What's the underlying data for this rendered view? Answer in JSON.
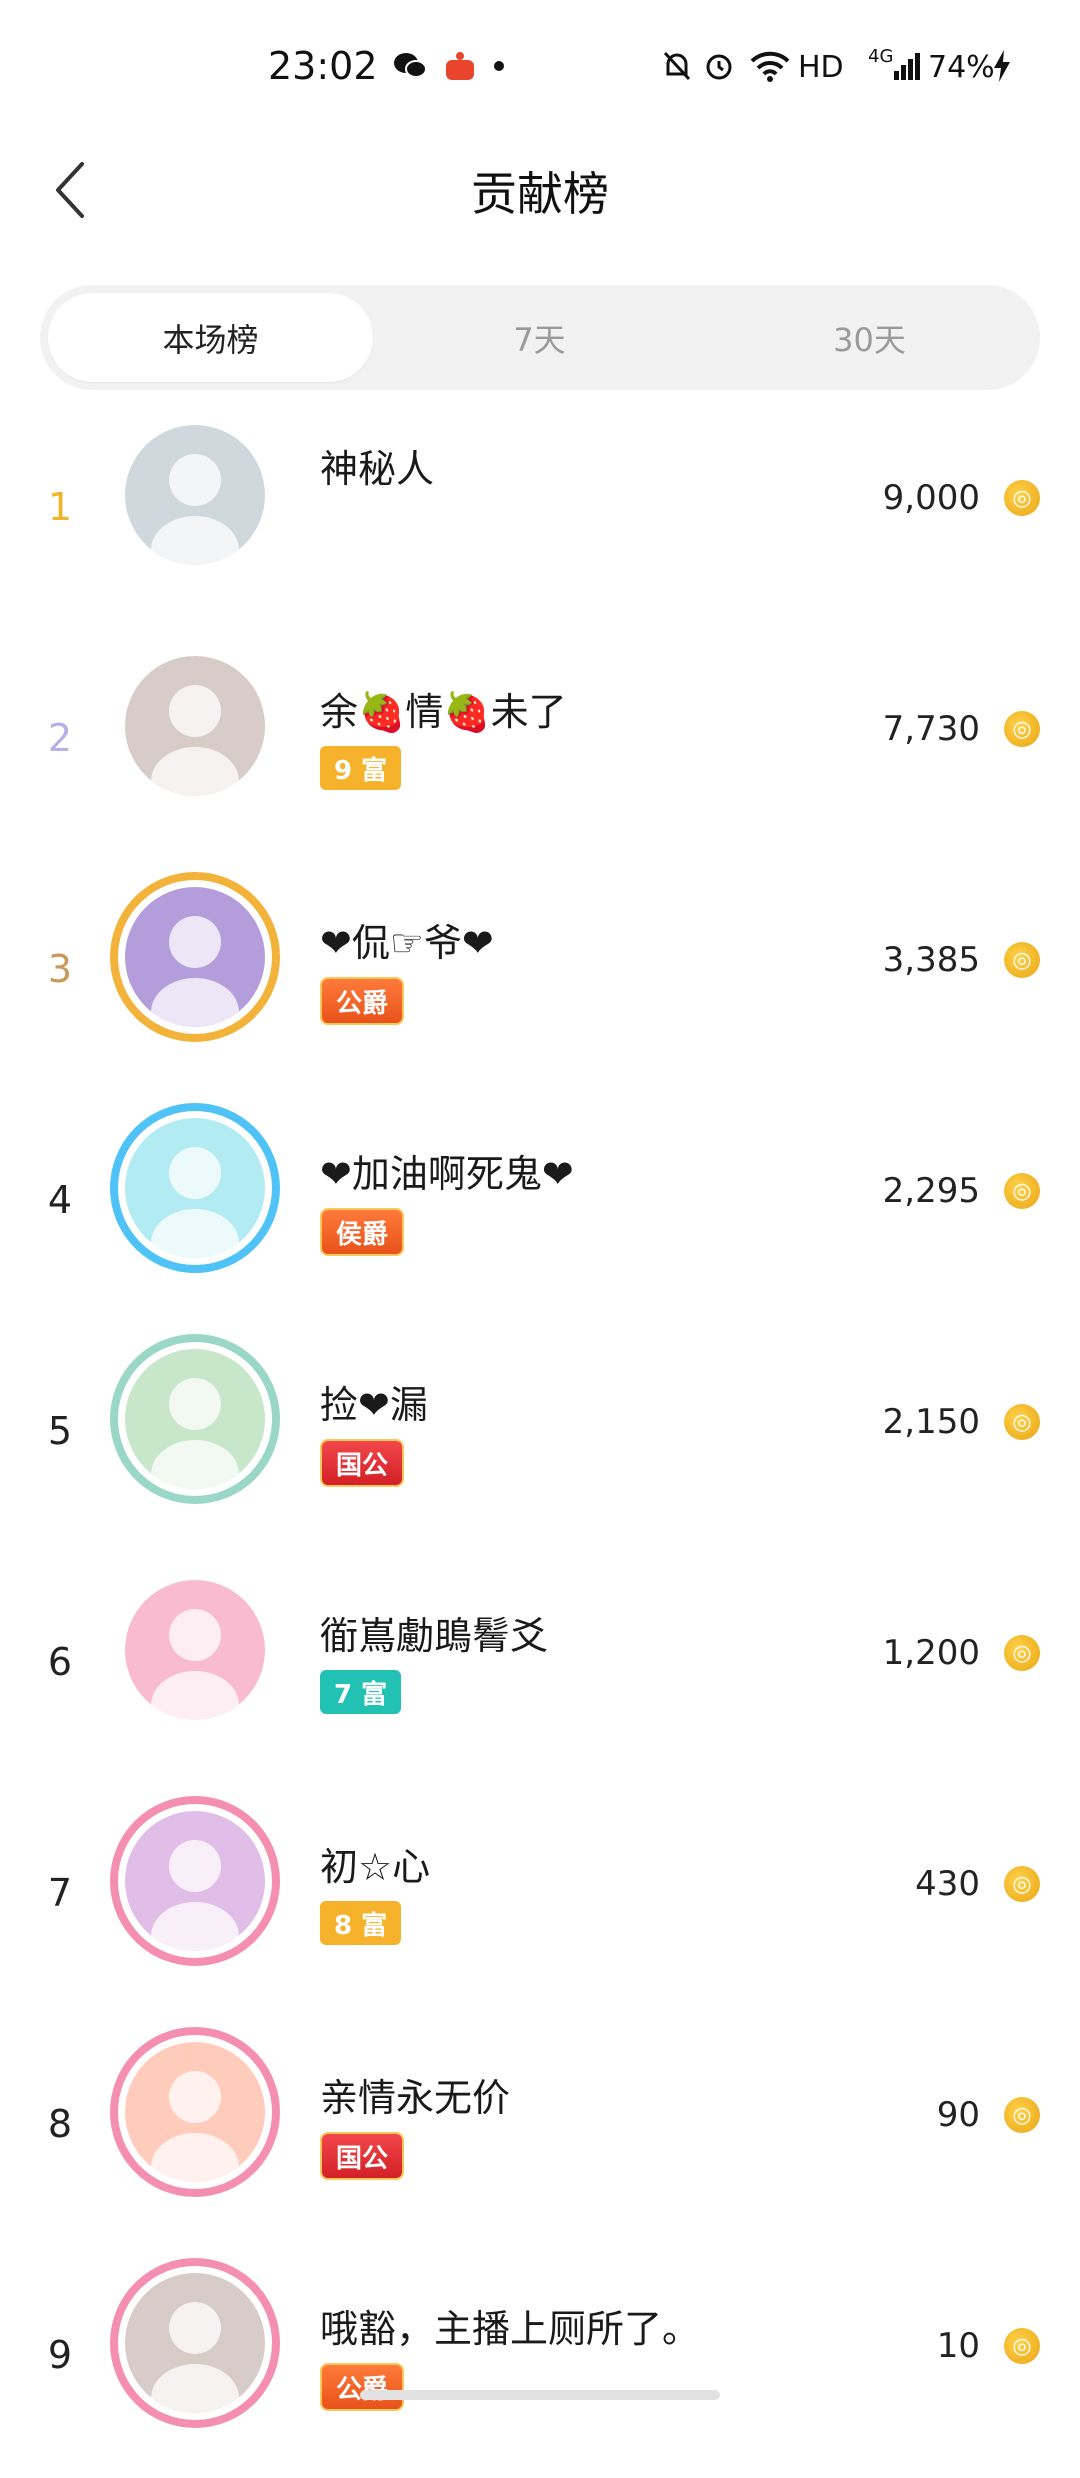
{
  "status_bar": {
    "time": "23:02",
    "network": "HD",
    "signal_label": "4G",
    "battery": "74%"
  },
  "header": {
    "title": "贡献榜"
  },
  "tabs": [
    {
      "label": "本场榜",
      "active": true
    },
    {
      "label": "7天",
      "active": false
    },
    {
      "label": "30天",
      "active": false
    }
  ],
  "ranking": [
    {
      "rank": "1",
      "name": "神秘人",
      "badge": "",
      "score": "9,000",
      "rank_color": "#f0b429"
    },
    {
      "rank": "2",
      "name": "余🍓情🍓未了",
      "badge": "9 富",
      "badge_type": "fu-gold",
      "score": "7,730",
      "rank_color": "#b6b0e6"
    },
    {
      "rank": "3",
      "name": "❤侃☞爷❤",
      "badge": "公爵",
      "badge_type": "rank-orange",
      "score": "3,385",
      "rank_color": "#c9985a"
    },
    {
      "rank": "4",
      "name": "❤加油啊死鬼❤",
      "badge": "侯爵",
      "badge_type": "rank-orange",
      "score": "2,295",
      "rank_color": "#222222"
    },
    {
      "rank": "5",
      "name": "捡❤漏",
      "badge": "国公",
      "badge_type": "rank-red",
      "score": "2,150",
      "rank_color": "#222222"
    },
    {
      "rank": "6",
      "name": "衜嶌勴鴡鬌爻",
      "badge": "7 富",
      "badge_type": "fu-teal",
      "score": "1,200",
      "rank_color": "#222222"
    },
    {
      "rank": "7",
      "name": "初☆心",
      "badge": "8 富",
      "badge_type": "fu-gold",
      "score": "430",
      "rank_color": "#222222"
    },
    {
      "rank": "8",
      "name": "亲情永无价",
      "badge": "国公",
      "badge_type": "rank-red",
      "score": "90",
      "rank_color": "#222222"
    },
    {
      "rank": "9",
      "name": "哦豁，主播上厕所了。",
      "badge": "公爵",
      "badge_type": "rank-orange",
      "score": "10",
      "rank_color": "#222222"
    }
  ],
  "coin_symbol": "◎",
  "colors": {
    "accent_gold": "#f0b429",
    "tab_bg": "#f2f2f2"
  }
}
